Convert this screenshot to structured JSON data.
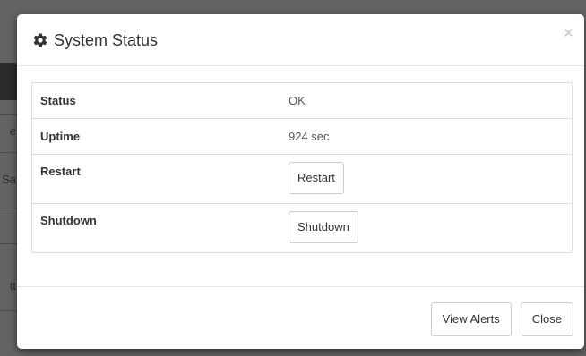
{
  "background": {
    "fragments": [
      "e",
      "Sa",
      "tt"
    ]
  },
  "dialog": {
    "title": "System Status",
    "title_icon": "gear-icon",
    "close_glyph": "×"
  },
  "table": {
    "rows": [
      {
        "label": "Status",
        "value": "OK"
      },
      {
        "label": "Uptime",
        "value": "924 sec"
      },
      {
        "label": "Restart",
        "button": "Restart"
      },
      {
        "label": "Shutdown",
        "button": "Shutdown"
      }
    ]
  },
  "footer": {
    "view_alerts": "View Alerts",
    "close": "Close"
  },
  "colors": {
    "overlay": "#636363",
    "border": "#dddddd",
    "close_icon": "#c6c6c6"
  }
}
